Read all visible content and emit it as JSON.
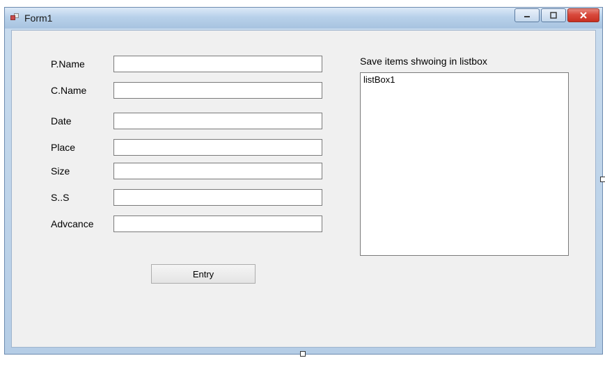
{
  "window": {
    "title": "Form1"
  },
  "form": {
    "fields": {
      "pname": {
        "label": "P.Name",
        "value": ""
      },
      "cname": {
        "label": "C.Name",
        "value": ""
      },
      "date": {
        "label": "Date",
        "value": ""
      },
      "place": {
        "label": "Place",
        "value": ""
      },
      "size": {
        "label": "Size",
        "value": ""
      },
      "ss": {
        "label": "S..S",
        "value": ""
      },
      "advance": {
        "label": "Advcance",
        "value": ""
      }
    },
    "entry_button": "Entry"
  },
  "listbox": {
    "caption": "Save items shwoing in listbox",
    "items": [
      "listBox1"
    ]
  }
}
